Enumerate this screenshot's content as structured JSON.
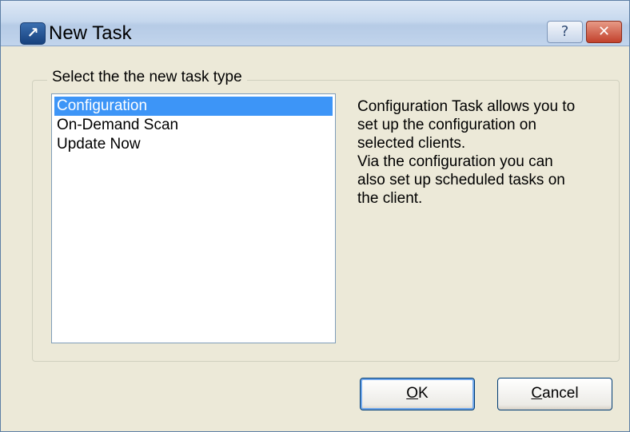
{
  "window": {
    "title": "New Task",
    "help_glyph": "?",
    "close_glyph": "✕",
    "app_icon_glyph": "↗"
  },
  "group": {
    "title": "Select the the new task type"
  },
  "task_types": [
    {
      "label": "Configuration",
      "selected": true
    },
    {
      "label": "On-Demand Scan",
      "selected": false
    },
    {
      "label": "Update Now",
      "selected": false
    }
  ],
  "description": {
    "lines": [
      "Configuration Task allows you to",
      "set up the configuration on",
      "selected clients.",
      "Via the configuration you can",
      "also set up scheduled tasks on",
      "the client."
    ]
  },
  "buttons": {
    "ok_mnemonic": "O",
    "ok_rest": "K",
    "cancel_mnemonic": "C",
    "cancel_rest": "ancel"
  },
  "colors": {
    "selection": "#3d95f7",
    "close_button": "#c2412c"
  }
}
